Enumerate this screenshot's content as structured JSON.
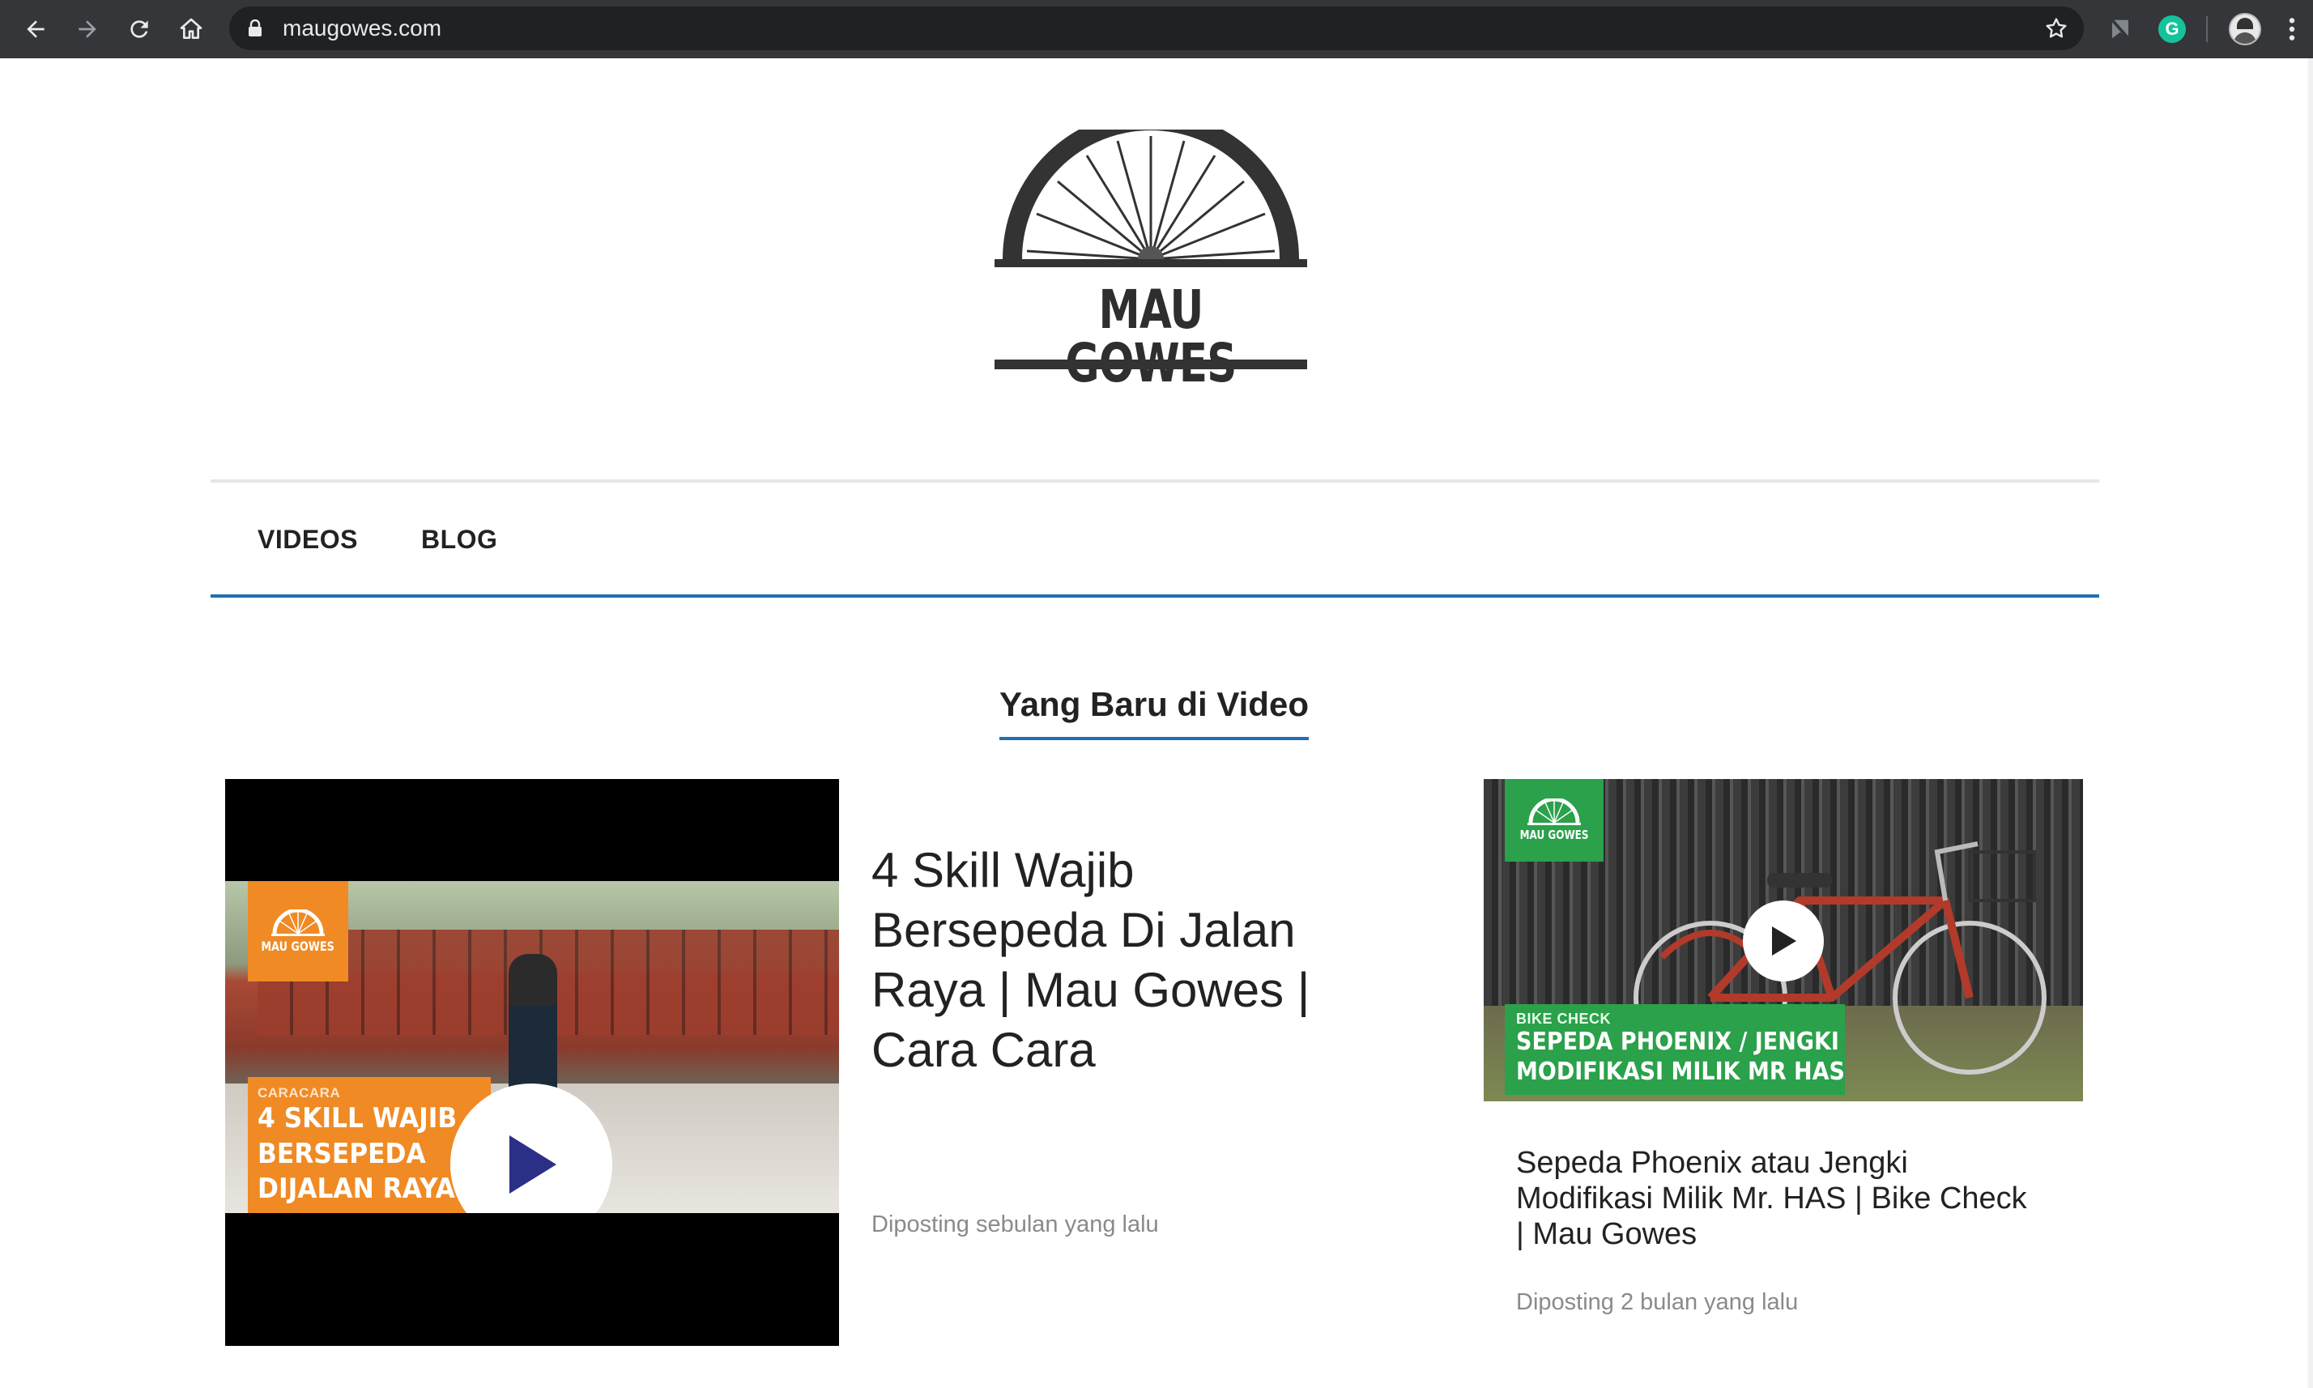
{
  "browser": {
    "url": "maugowes.com",
    "icons": {
      "back": "back-arrow-icon",
      "forward": "forward-arrow-icon",
      "reload": "reload-icon",
      "home": "home-icon",
      "lock": "lock-icon",
      "bookmark": "star-icon",
      "extension_flag": "flag-extension-icon",
      "grammarly": "grammarly-icon",
      "profile": "avatar",
      "menu": "kebab-menu-icon"
    },
    "grammarly_letter": "G"
  },
  "header": {
    "logo_text": "MAU GOWES"
  },
  "nav": {
    "items": [
      {
        "label": "VIDEOS"
      },
      {
        "label": "BLOG"
      }
    ]
  },
  "section": {
    "title": "Yang Baru di Video"
  },
  "videos": [
    {
      "title": "4 Skill Wajib Bersepeda Di Jalan Raya | Mau Gowes | Cara Cara",
      "posted": "Diposting sebulan yang lalu",
      "thumb_badge": "MAU GOWES",
      "thumb_category": "CARACARA",
      "thumb_lines": [
        "4 SKILL WAJIB",
        "BERSEPEDA",
        "DIJALAN RAYA"
      ],
      "accent": "#f08a24"
    },
    {
      "title": "Sepeda Phoenix atau Jengki Modifikasi Milik Mr. HAS | Bike Check | Mau Gowes",
      "posted": "Diposting 2 bulan yang lalu",
      "thumb_badge": "MAU GOWES",
      "thumb_category": "BIKE CHECK",
      "thumb_lines": [
        "SEPEDA PHOENIX / JENGKI",
        "MODIFIKASI MILIK MR HAS"
      ],
      "accent": "#2aa14a"
    }
  ],
  "colors": {
    "nav_underline": "#1f6fb5",
    "chrome_bg": "#35363a",
    "omnibox_bg": "#202124"
  }
}
